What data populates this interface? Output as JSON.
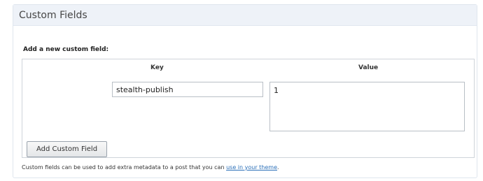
{
  "panel": {
    "title": "Custom Fields"
  },
  "form": {
    "subheading": "Add a new custom field:",
    "key_header": "Key",
    "value_header": "Value",
    "key_value": "stealth-publish",
    "value_value": "1",
    "add_button_label": "Add Custom Field"
  },
  "help": {
    "text_before": "Custom fields can be used to add extra metadata to a post that you can ",
    "link_text": "use in your theme",
    "text_after": "."
  },
  "colors": {
    "header_background": "#eef2f8",
    "link": "#2a6fb8",
    "border": "#cfd4da"
  }
}
